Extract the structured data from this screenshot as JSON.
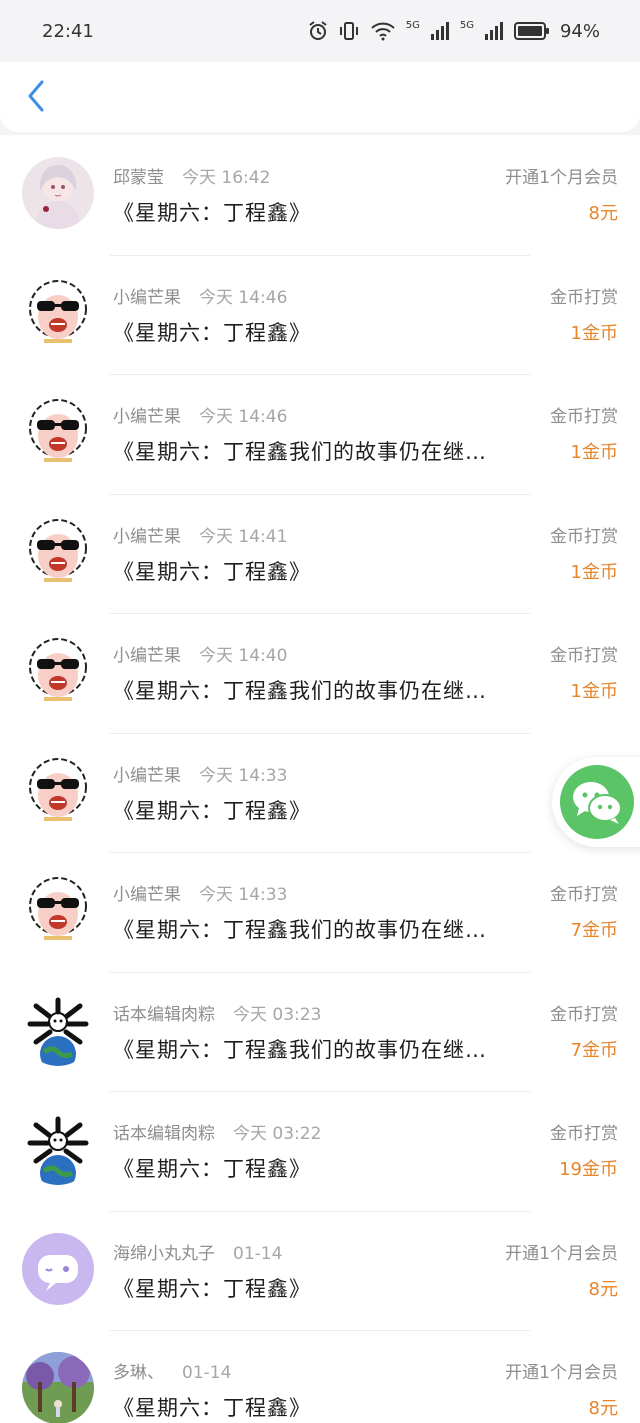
{
  "status": {
    "time": "22:41",
    "battery": "94%",
    "network1": "6",
    "network2": "5G",
    "network3": "5G"
  },
  "nav": {
    "back_icon": "chevron-left-icon",
    "accent": "#3a8ee6"
  },
  "colors": {
    "amount": "#e8852b",
    "wechat": "#5ac467"
  },
  "records": [
    {
      "user": "邱蒙莹",
      "time": "今天 16:42",
      "book": "《星期六：丁程鑫》",
      "type": "开通1个月会员",
      "amount": "8元",
      "avatar": "girl-avatar"
    },
    {
      "user": "小编芒果",
      "time": "今天 14:46",
      "book": "《星期六：丁程鑫》",
      "type": "金币打赏",
      "amount": "1金币",
      "avatar": "sunglasses-sheep-avatar"
    },
    {
      "user": "小编芒果",
      "time": "今天 14:46",
      "book": "《星期六：丁程鑫我们的故事仍在继…",
      "type": "金币打赏",
      "amount": "1金币",
      "avatar": "sunglasses-sheep-avatar"
    },
    {
      "user": "小编芒果",
      "time": "今天 14:41",
      "book": "《星期六：丁程鑫》",
      "type": "金币打赏",
      "amount": "1金币",
      "avatar": "sunglasses-sheep-avatar"
    },
    {
      "user": "小编芒果",
      "time": "今天 14:40",
      "book": "《星期六：丁程鑫我们的故事仍在继…",
      "type": "金币打赏",
      "amount": "1金币",
      "avatar": "sunglasses-sheep-avatar"
    },
    {
      "user": "小编芒果",
      "time": "今天 14:33",
      "book": "《星期六：丁程鑫》",
      "type": "金",
      "amount": "",
      "avatar": "sunglasses-sheep-avatar"
    },
    {
      "user": "小编芒果",
      "time": "今天 14:33",
      "book": "《星期六：丁程鑫我们的故事仍在继…",
      "type": "金币打赏",
      "amount": "7金币",
      "avatar": "sunglasses-sheep-avatar"
    },
    {
      "user": "话本编辑肉粽",
      "time": "今天 03:23",
      "book": "《星期六：丁程鑫我们的故事仍在继…",
      "type": "金币打赏",
      "amount": "7金币",
      "avatar": "panda-earth-avatar"
    },
    {
      "user": "话本编辑肉粽",
      "time": "今天 03:22",
      "book": "《星期六：丁程鑫》",
      "type": "金币打赏",
      "amount": "19金币",
      "avatar": "panda-earth-avatar"
    },
    {
      "user": "海绵小丸丸子",
      "time": "01-14",
      "book": "《星期六：丁程鑫》",
      "type": "开通1个月会员",
      "amount": "8元",
      "avatar": "purple-chat-avatar"
    },
    {
      "user": "多琳、",
      "time": "01-14",
      "book": "《星期六：丁程鑫》",
      "type": "开通1个月会员",
      "amount": "8元",
      "avatar": "forest-avatar"
    }
  ],
  "float": {
    "icon": "wechat-icon"
  }
}
